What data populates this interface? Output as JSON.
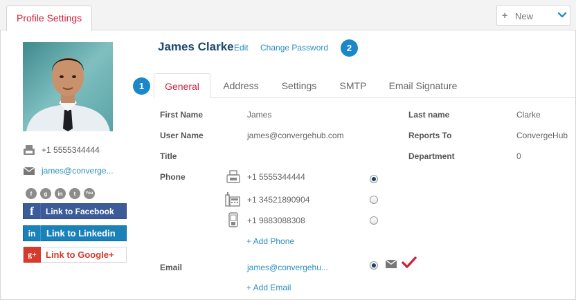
{
  "top": {
    "profile_tab": "Profile Settings",
    "new_label": "New",
    "new_plus": "+"
  },
  "sidebar": {
    "phone": "+1 5555344444",
    "email": "james@converge...",
    "social_icons": [
      "facebook-icon",
      "google-plus-icon",
      "linkedin-icon",
      "twitter-icon",
      "youtube-icon"
    ],
    "social_glyphs": [
      "f",
      "g",
      "in",
      "t",
      "You"
    ],
    "facebook": {
      "glyph": "f",
      "label": "Link to Facebook",
      "color": "#3b5b99"
    },
    "linkedin": {
      "glyph": "in",
      "label": "Link to Linkedin",
      "color": "#1a82b8"
    },
    "google": {
      "glyph": "g+",
      "label": "Link to Google+",
      "color": "#d53a2c"
    }
  },
  "header": {
    "name": "James Clarke",
    "edit": "Edit",
    "change_password": "Change Password",
    "badge1": "1",
    "badge2": "2"
  },
  "tabs": [
    "General",
    "Address",
    "Settings",
    "SMTP",
    "Email Signature"
  ],
  "active_tab": "General",
  "form": {
    "first_name": {
      "label": "First Name",
      "value": "James"
    },
    "last_name": {
      "label": "Last name",
      "value": "Clarke"
    },
    "user_name": {
      "label": "User Name",
      "value": "james@convergehub.com"
    },
    "reports_to": {
      "label": "Reports To",
      "value": "ConvergeHub"
    },
    "title": {
      "label": "Title",
      "value": ""
    },
    "department": {
      "label": "Department",
      "value": "0"
    },
    "phone": {
      "label": "Phone",
      "entries": [
        {
          "type": "fax",
          "number": "+1 5555344444",
          "primary": true
        },
        {
          "type": "office",
          "number": "+1 34521890904",
          "primary": false
        },
        {
          "type": "mobile",
          "number": "+1 9883088308",
          "primary": false
        }
      ],
      "add": "+ Add Phone"
    },
    "email": {
      "label": "Email",
      "value": "james@convergehu...",
      "primary": true,
      "add": "+ Add Email"
    }
  },
  "colors": {
    "accent_red": "#d0223a",
    "link_blue": "#2a8fbd",
    "badge_blue": "#1a87c8",
    "name_navy": "#1a4a6e"
  }
}
